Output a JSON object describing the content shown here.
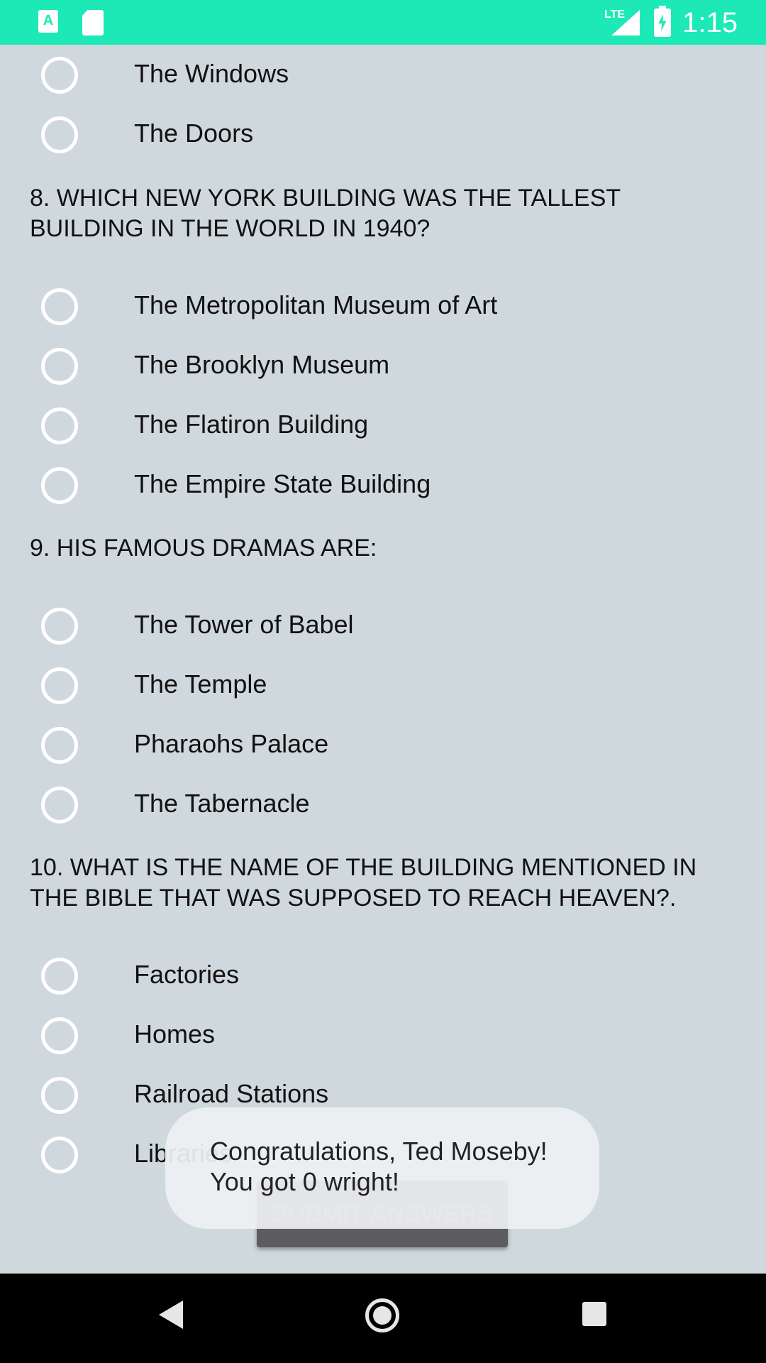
{
  "status_bar": {
    "network_label": "LTE",
    "time": "1:15",
    "app_icon_letter": "A"
  },
  "question_7_tail": {
    "options": [
      "The Windows",
      "The Doors"
    ]
  },
  "question_8": {
    "text_line1": "8. WHICH NEW YORK BUILDING WAS THE TALLEST",
    "text_line2": "BUILDING IN THE WORLD IN 1940?",
    "options": [
      "The Metropolitan Museum of Art",
      "The Brooklyn Museum",
      "The Flatiron Building",
      "The Empire State Building"
    ]
  },
  "question_9": {
    "text": "9. HIS FAMOUS DRAMAS ARE:",
    "options": [
      "The Tower of Babel",
      "The Temple",
      "Pharaohs Palace",
      "The Tabernacle"
    ]
  },
  "question_10": {
    "text_line1": "10. WHAT IS THE NAME OF THE BUILDING MENTIONED IN",
    "text_line2": "THE BIBLE THAT WAS SUPPOSED TO REACH HEAVEN?.",
    "options": [
      "Factories",
      "Homes",
      "Railroad Stations",
      "Libraries"
    ]
  },
  "submit_label": "SUBMIT ANSWERS",
  "toast": {
    "line1": "Congratulations, Ted Moseby!",
    "line2": "You got 0 wright!"
  },
  "colors": {
    "status_bar": "#1de9b6",
    "background": "#cfd8dc",
    "button": "#5d5d5f"
  },
  "icons": {
    "nav_back": "back-triangle-icon",
    "nav_home": "home-circle-icon",
    "nav_recent": "recent-apps-square-icon"
  }
}
